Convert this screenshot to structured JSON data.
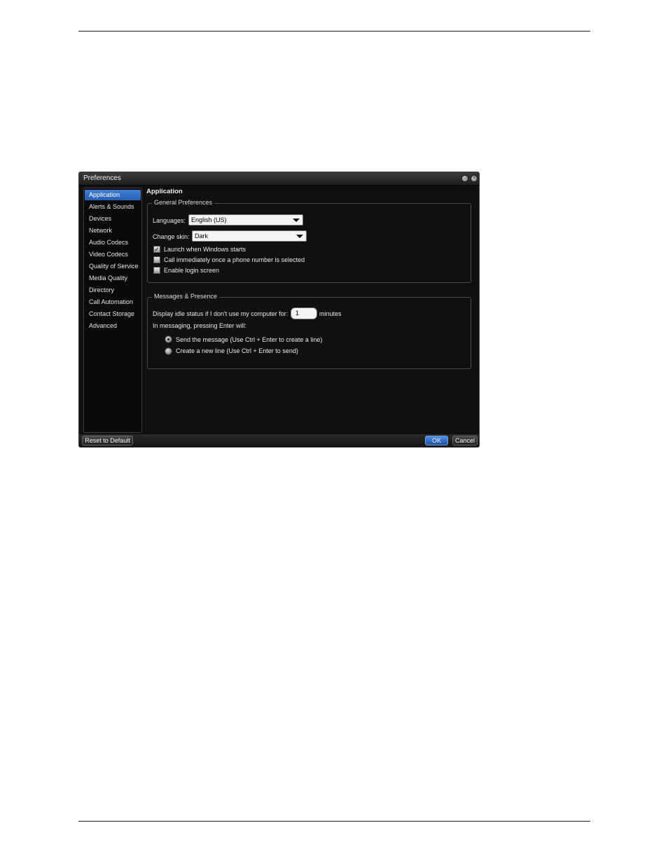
{
  "window": {
    "title": "Preferences"
  },
  "sidebar": {
    "items": [
      {
        "label": "Application",
        "selected": true
      },
      {
        "label": "Alerts & Sounds"
      },
      {
        "label": "Devices"
      },
      {
        "label": "Network"
      },
      {
        "label": "Audio Codecs"
      },
      {
        "label": "Video Codecs"
      },
      {
        "label": "Quality of Service"
      },
      {
        "label": "Media Quality"
      },
      {
        "label": "Directory"
      },
      {
        "label": "Call Automation"
      },
      {
        "label": "Contact Storage"
      },
      {
        "label": "Advanced"
      }
    ]
  },
  "main": {
    "title": "Application",
    "general": {
      "legend": "General Preferences",
      "languages_label": "Languages:",
      "languages_value": "English (US)",
      "skin_label": "Change skin:",
      "skin_value": "Dark",
      "launch_label": "Launch when Windows starts",
      "launch_checked": true,
      "call_label": "Call immediately once a phone number is selected",
      "call_checked": false,
      "login_label": "Enable login screen",
      "login_checked": false
    },
    "messages": {
      "legend": "Messages & Presence",
      "idle_label": "Display idle status if I don't use my computer for:",
      "idle_value": "1",
      "idle_unit": "minutes",
      "enter_label": "In messaging, pressing Enter will:",
      "option_send": "Send the message (Use Ctrl + Enter to create a line)",
      "option_newline": "Create a new line (Use Ctrl + Enter to send)",
      "selected_option": "send"
    }
  },
  "footer": {
    "reset_label": "Reset to Default",
    "ok_label": "OK",
    "cancel_label": "Cancel"
  },
  "colors": {
    "accent": "#2f6cc4",
    "background": "#101010"
  },
  "icons": [
    "minimize-icon",
    "close-icon",
    "chevron-down-icon",
    "checkmark-icon"
  ]
}
